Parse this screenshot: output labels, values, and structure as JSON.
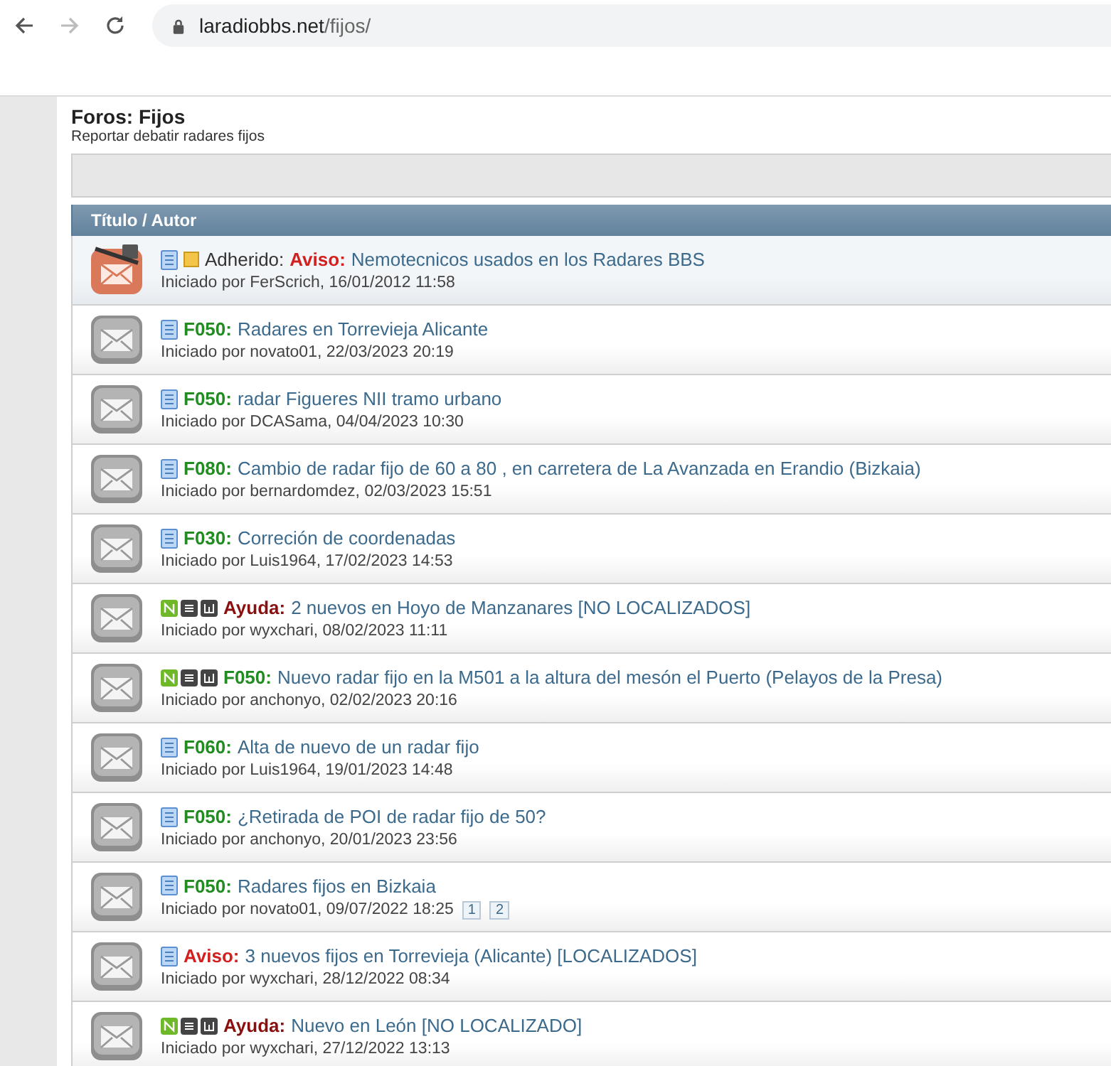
{
  "browser": {
    "url_host": "laradiobbs.net",
    "url_path": "/fijos/"
  },
  "forum": {
    "title": "Foros: Fijos",
    "description": "Reportar debatir radares fijos"
  },
  "table": {
    "header": "Título / Autor",
    "threads": [
      {
        "envelope": {
          "kind": "sticky"
        },
        "badge": {
          "kind": "doc"
        },
        "sticky_label": "Adherido:",
        "prefix": {
          "text": "Aviso:",
          "kind": "aviso"
        },
        "title": "Nemotecnicos usados en los Radares BBS",
        "starter": "Iniciado por FerScrich, 16/01/2012 11:58"
      },
      {
        "envelope": {
          "kind": "normal"
        },
        "badge": {
          "kind": "doc"
        },
        "prefix": {
          "text": "F050:",
          "kind": "code"
        },
        "title": "Radares en Torrevieja Alicante",
        "starter": "Iniciado por novato01, 22/03/2023 20:19"
      },
      {
        "envelope": {
          "kind": "normal"
        },
        "badge": {
          "kind": "doc"
        },
        "prefix": {
          "text": "F050:",
          "kind": "code"
        },
        "title": "radar Figueres NII tramo urbano",
        "starter": "Iniciado por DCASama, 04/04/2023 10:30"
      },
      {
        "envelope": {
          "kind": "normal"
        },
        "badge": {
          "kind": "doc"
        },
        "prefix": {
          "text": "F080:",
          "kind": "code"
        },
        "title": "Cambio de radar fijo de 60 a 80 , en carretera de La Avanzada en Erandio (Bizkaia)",
        "starter": "Iniciado por bernardomdez, 02/03/2023 15:51"
      },
      {
        "envelope": {
          "kind": "normal"
        },
        "badge": {
          "kind": "doc"
        },
        "prefix": {
          "text": "F030:",
          "kind": "code"
        },
        "title": "Correción de coordenadas",
        "starter": "Iniciado por Luis1964, 17/02/2023 14:53"
      },
      {
        "envelope": {
          "kind": "normal"
        },
        "badge": {
          "kind": "new"
        },
        "prefix": {
          "text": "Ayuda:",
          "kind": "ayuda"
        },
        "title": "2 nuevos en Hoyo de Manzanares [NO LOCALIZADOS]",
        "starter": "Iniciado por wyxchari, 08/02/2023 11:11"
      },
      {
        "envelope": {
          "kind": "normal"
        },
        "badge": {
          "kind": "new"
        },
        "prefix": {
          "text": "F050:",
          "kind": "code"
        },
        "title": "Nuevo radar fijo en la M501 a la altura del mesón el Puerto (Pelayos de la Presa)",
        "starter": "Iniciado por anchonyo, 02/02/2023 20:16"
      },
      {
        "envelope": {
          "kind": "normal"
        },
        "badge": {
          "kind": "doc"
        },
        "prefix": {
          "text": "F060:",
          "kind": "code"
        },
        "title": "Alta de nuevo de un radar fijo",
        "starter": "Iniciado por Luis1964, 19/01/2023 14:48"
      },
      {
        "envelope": {
          "kind": "normal"
        },
        "badge": {
          "kind": "doc"
        },
        "prefix": {
          "text": "F050:",
          "kind": "code"
        },
        "title": "¿Retirada de POI de radar fijo de 50?",
        "starter": "Iniciado por anchonyo, 20/01/2023 23:56"
      },
      {
        "envelope": {
          "kind": "normal"
        },
        "badge": {
          "kind": "doc"
        },
        "prefix": {
          "text": "F050:",
          "kind": "code"
        },
        "title": "Radares fijos en Bizkaia",
        "starter": "Iniciado por novato01, 09/07/2022 18:25",
        "pages": [
          "1",
          "2"
        ]
      },
      {
        "envelope": {
          "kind": "normal"
        },
        "badge": {
          "kind": "doc"
        },
        "prefix": {
          "text": "Aviso:",
          "kind": "aviso"
        },
        "title": "3 nuevos fijos en Torrevieja (Alicante) [LOCALIZADOS]",
        "starter": "Iniciado por wyxchari, 28/12/2022 08:34"
      },
      {
        "envelope": {
          "kind": "normal"
        },
        "badge": {
          "kind": "new"
        },
        "prefix": {
          "text": "Ayuda:",
          "kind": "ayuda"
        },
        "title": "Nuevo en León [NO LOCALIZADO]",
        "starter": "Iniciado por wyxchari, 27/12/2022 13:13"
      }
    ]
  }
}
